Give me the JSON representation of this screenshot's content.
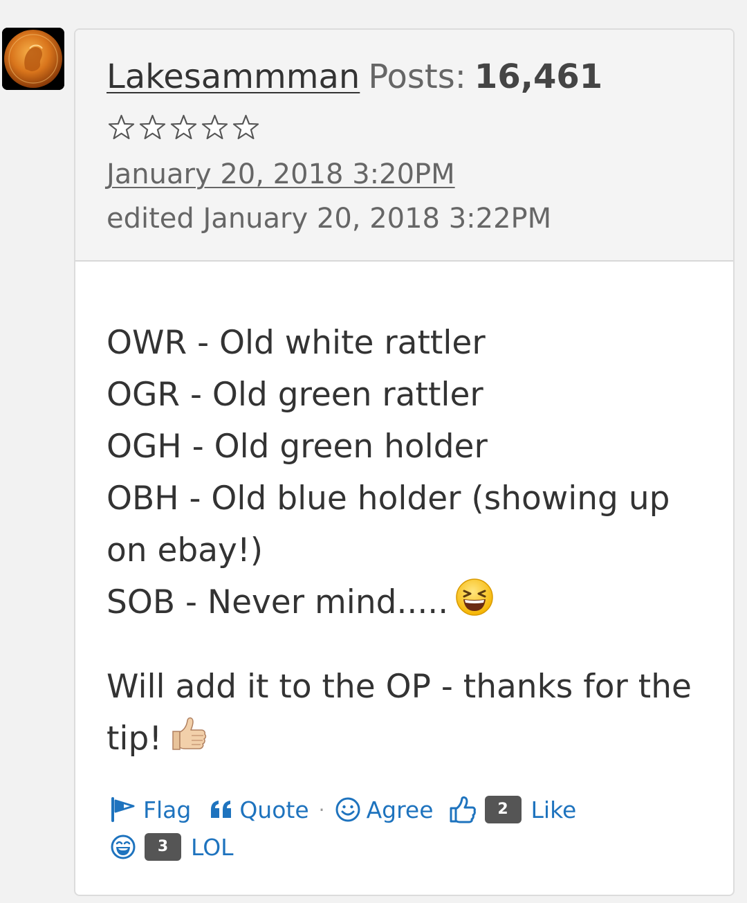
{
  "post": {
    "author": {
      "name": "Lakesammman",
      "posts_label": "Posts:",
      "posts_count": "16,461",
      "rating_stars": 5
    },
    "date": "January 20, 2018 3:20PM",
    "edited": "edited January 20, 2018 3:22PM",
    "body": {
      "lines": [
        "OWR - Old white rattler",
        "OGR - Old green rattler",
        "OGH - Old green holder",
        "OBH - Old blue holder (showing up",
        "on ebay!)",
        "SOB - Never mind....."
      ],
      "closing": [
        "Will add it to the OP - thanks for the",
        "tip!"
      ]
    }
  },
  "reactions": {
    "flag_label": "Flag",
    "quote_label": "Quote",
    "separator": "·",
    "agree_label": "Agree",
    "like_count": "2",
    "like_label": "Like",
    "lol_count": "3",
    "lol_label": "LOL"
  },
  "colors": {
    "link_blue": "#1e73be",
    "badge_gray": "#555555",
    "header_bg": "#f4f4f4"
  }
}
